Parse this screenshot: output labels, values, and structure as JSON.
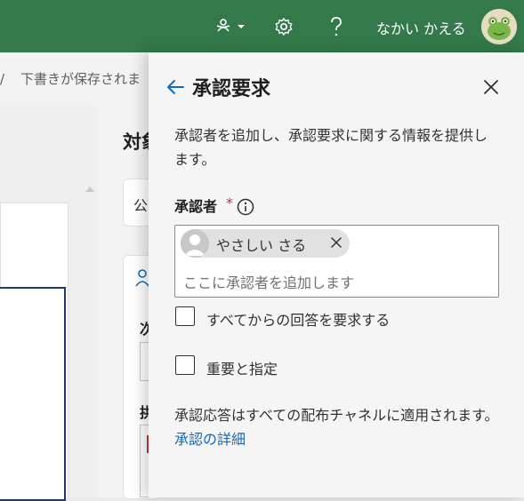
{
  "topbar": {
    "user_name": "なかい かえる",
    "icons": [
      "share-dropdown-icon",
      "gear-icon",
      "help-icon"
    ],
    "colors": {
      "bar": "#33794a",
      "accent": "#0f6cbd"
    }
  },
  "background": {
    "draft_status": "下書きが保存されま",
    "title_fragment": "対象",
    "box_fragment": "公",
    "label1_fragment": "次",
    "label2_fragment": "拱"
  },
  "panel": {
    "title": "承認要求",
    "description": "承認者を追加し、承認要求に関する情報を提供します。",
    "approver": {
      "label": "承認者",
      "required_mark": "*",
      "chip_name": "やさしい さる",
      "placeholder": "ここに承認者を追加します"
    },
    "checkboxes": [
      {
        "label": "すべてからの回答を要求する",
        "checked": false
      },
      {
        "label": "重要と指定",
        "checked": false
      }
    ],
    "footer": {
      "text": "承認応答はすべての配布チャネルに適用されます。",
      "link": "承認の詳細"
    }
  }
}
